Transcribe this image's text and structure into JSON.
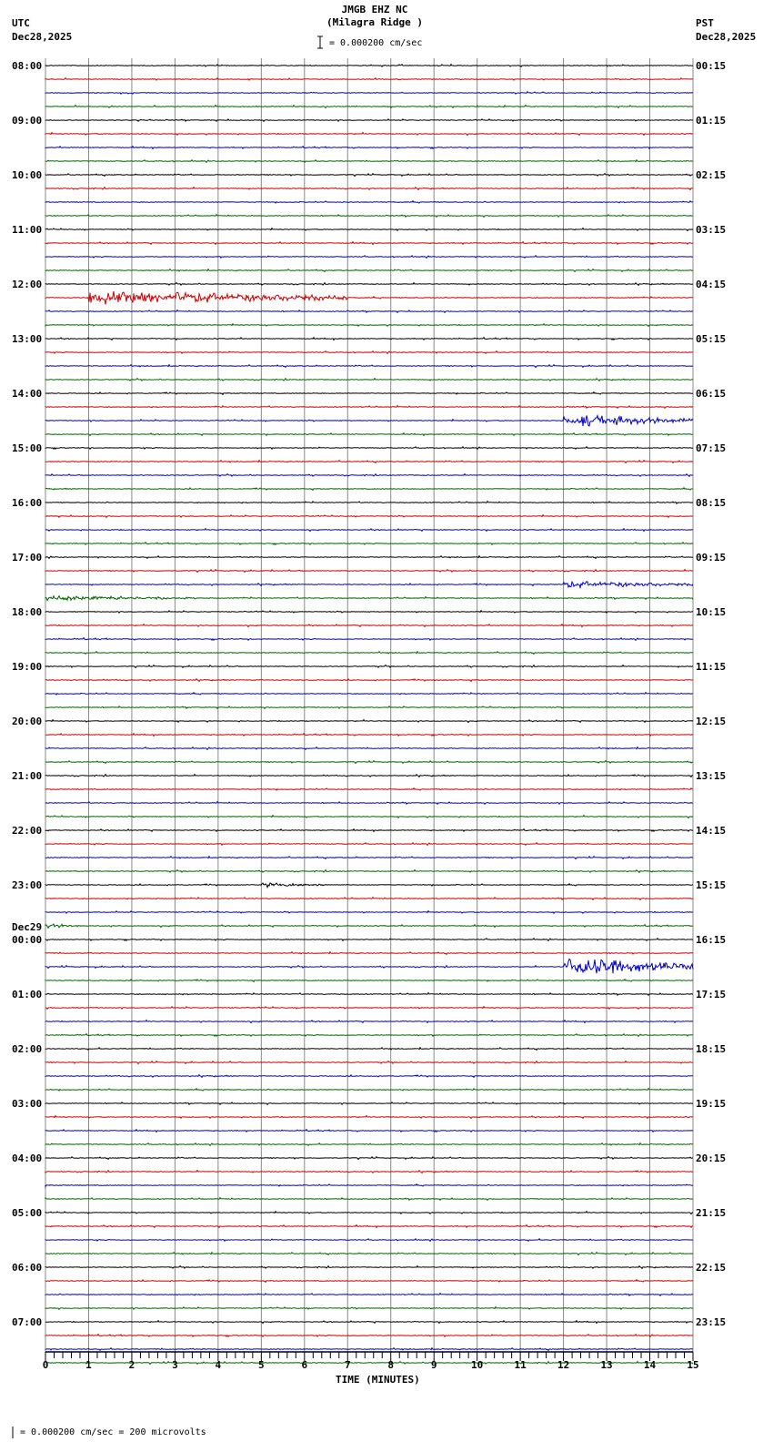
{
  "header": {
    "station": "JMGB EHZ NC",
    "location": "(Milagra Ridge )",
    "left_zone": "UTC",
    "left_date": "Dec28,2025",
    "right_zone": "PST",
    "right_date": "Dec28,2025",
    "scale_text": "= 0.000200 cm/sec"
  },
  "footer": {
    "scale_text": "= 0.000200 cm/sec =     200 microvolts"
  },
  "colors": [
    "#000000",
    "#cc0000",
    "#0000cc",
    "#006600"
  ],
  "chart_data": {
    "type": "line",
    "title": "JMGB EHZ NC (Milagra Ridge )",
    "xlabel": "TIME (MINUTES)",
    "xlim": [
      0,
      15
    ],
    "x_ticks": [
      "0",
      "1",
      "2",
      "3",
      "4",
      "5",
      "6",
      "7",
      "8",
      "9",
      "10",
      "11",
      "12",
      "13",
      "14",
      "15"
    ],
    "traces_per_hour": 4,
    "trace_count": 96,
    "left_labels": [
      {
        "row": 0,
        "text": "08:00"
      },
      {
        "row": 4,
        "text": "09:00"
      },
      {
        "row": 8,
        "text": "10:00"
      },
      {
        "row": 12,
        "text": "11:00"
      },
      {
        "row": 16,
        "text": "12:00"
      },
      {
        "row": 20,
        "text": "13:00"
      },
      {
        "row": 24,
        "text": "14:00"
      },
      {
        "row": 28,
        "text": "15:00"
      },
      {
        "row": 32,
        "text": "16:00"
      },
      {
        "row": 36,
        "text": "17:00"
      },
      {
        "row": 40,
        "text": "18:00"
      },
      {
        "row": 44,
        "text": "19:00"
      },
      {
        "row": 48,
        "text": "20:00"
      },
      {
        "row": 52,
        "text": "21:00"
      },
      {
        "row": 56,
        "text": "22:00"
      },
      {
        "row": 60,
        "text": "23:00"
      },
      {
        "row": 64,
        "text": "00:00",
        "date": "Dec29"
      },
      {
        "row": 68,
        "text": "01:00"
      },
      {
        "row": 72,
        "text": "02:00"
      },
      {
        "row": 76,
        "text": "03:00"
      },
      {
        "row": 80,
        "text": "04:00"
      },
      {
        "row": 84,
        "text": "05:00"
      },
      {
        "row": 88,
        "text": "06:00"
      },
      {
        "row": 92,
        "text": "07:00"
      }
    ],
    "right_labels": [
      "00:15",
      "01:15",
      "02:15",
      "03:15",
      "04:15",
      "05:15",
      "06:15",
      "07:15",
      "08:15",
      "09:15",
      "10:15",
      "11:15",
      "12:15",
      "13:15",
      "14:15",
      "15:15",
      "16:15",
      "17:15",
      "18:15",
      "19:15",
      "20:15",
      "21:15",
      "22:15",
      "23:15"
    ],
    "events": [
      {
        "row": 17,
        "start_min": 1.0,
        "end_min": 7.0,
        "amplitude": 8
      },
      {
        "row": 26,
        "start_min": 12.0,
        "end_min": 15.0,
        "amplitude": 7
      },
      {
        "row": 38,
        "start_min": 12.0,
        "end_min": 15.0,
        "amplitude": 4
      },
      {
        "row": 39,
        "start_min": 0.0,
        "end_min": 3.5,
        "amplitude": 3
      },
      {
        "row": 66,
        "start_min": 12.0,
        "end_min": 15.0,
        "amplitude": 10
      },
      {
        "row": 60,
        "start_min": 5.0,
        "end_min": 6.5,
        "amplitude": 3
      },
      {
        "row": 63,
        "start_min": 0.0,
        "end_min": 0.8,
        "amplitude": 3
      }
    ]
  }
}
